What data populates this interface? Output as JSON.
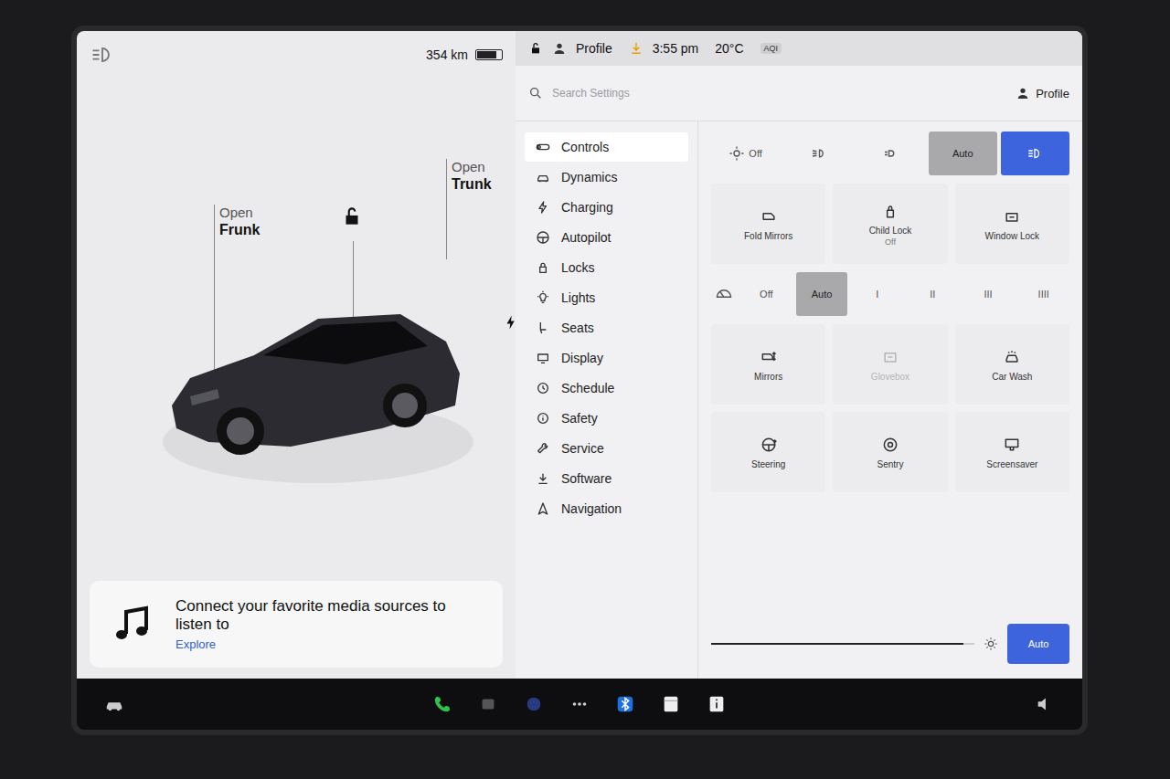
{
  "status": {
    "range": "354 km",
    "battery_level": 0.8
  },
  "top_bar": {
    "profile": "Profile",
    "time": "3:55 pm",
    "temperature": "20°C",
    "aqi": "AQI",
    "locked": false
  },
  "car_panel": {
    "frunk": {
      "action": "Open",
      "name": "Frunk"
    },
    "trunk": {
      "action": "Open",
      "name": "Trunk"
    },
    "locked": false,
    "charging": true
  },
  "media": {
    "message": "Connect your favorite media sources to listen to",
    "link": "Explore"
  },
  "search": {
    "placeholder": "Search Settings",
    "profile": "Profile"
  },
  "menu": [
    {
      "label": "Controls",
      "kind": "toggle",
      "selected": true
    },
    {
      "label": "Dynamics",
      "kind": "car",
      "selected": false
    },
    {
      "label": "Charging",
      "kind": "bolt",
      "selected": false
    },
    {
      "label": "Autopilot",
      "kind": "wheel",
      "selected": false
    },
    {
      "label": "Locks",
      "kind": "lock",
      "selected": false
    },
    {
      "label": "Lights",
      "kind": "bulb",
      "selected": false
    },
    {
      "label": "Seats",
      "kind": "seat",
      "selected": false
    },
    {
      "label": "Display",
      "kind": "display",
      "selected": false
    },
    {
      "label": "Schedule",
      "kind": "clock",
      "selected": false
    },
    {
      "label": "Safety",
      "kind": "info",
      "selected": false
    },
    {
      "label": "Service",
      "kind": "wrench",
      "selected": false
    },
    {
      "label": "Software",
      "kind": "download",
      "selected": false
    },
    {
      "label": "Navigation",
      "kind": "nav",
      "selected": false
    }
  ],
  "lights": [
    {
      "kind": "off",
      "label": "Off",
      "selected": false
    },
    {
      "kind": "fog",
      "label": "",
      "selected": false
    },
    {
      "kind": "parking",
      "label": "",
      "selected": false
    },
    {
      "kind": "auto",
      "label": "Auto",
      "selected": true
    },
    {
      "kind": "highbeam",
      "label": "",
      "selected": true
    }
  ],
  "tiles_top": [
    {
      "kind": "foldmirrors",
      "label": "Fold Mirrors",
      "sub": "",
      "disabled": false
    },
    {
      "kind": "childlock",
      "label": "Child Lock",
      "sub": "Off",
      "disabled": false
    },
    {
      "kind": "windowlock",
      "label": "Window Lock",
      "sub": "",
      "disabled": false
    }
  ],
  "wipers": [
    {
      "label": "Off",
      "selected": false
    },
    {
      "label": "Auto",
      "selected": true
    },
    {
      "label": "I",
      "selected": false
    },
    {
      "label": "II",
      "selected": false
    },
    {
      "label": "III",
      "selected": false
    },
    {
      "label": "IIII",
      "selected": false
    }
  ],
  "tiles_bottom": [
    {
      "kind": "mirrors",
      "label": "Mirrors",
      "sub": "",
      "disabled": false
    },
    {
      "kind": "glovebox",
      "label": "Glovebox",
      "sub": "",
      "disabled": true
    },
    {
      "kind": "carwash",
      "label": "Car Wash",
      "sub": "",
      "disabled": false
    },
    {
      "kind": "steering",
      "label": "Steering",
      "sub": "",
      "disabled": false
    },
    {
      "kind": "sentry",
      "label": "Sentry",
      "sub": "",
      "disabled": false
    },
    {
      "kind": "screensaver",
      "label": "Screensaver",
      "sub": "",
      "disabled": false
    }
  ],
  "brightness": {
    "level": 0.96,
    "auto": {
      "label": "Auto",
      "selected": true
    }
  }
}
